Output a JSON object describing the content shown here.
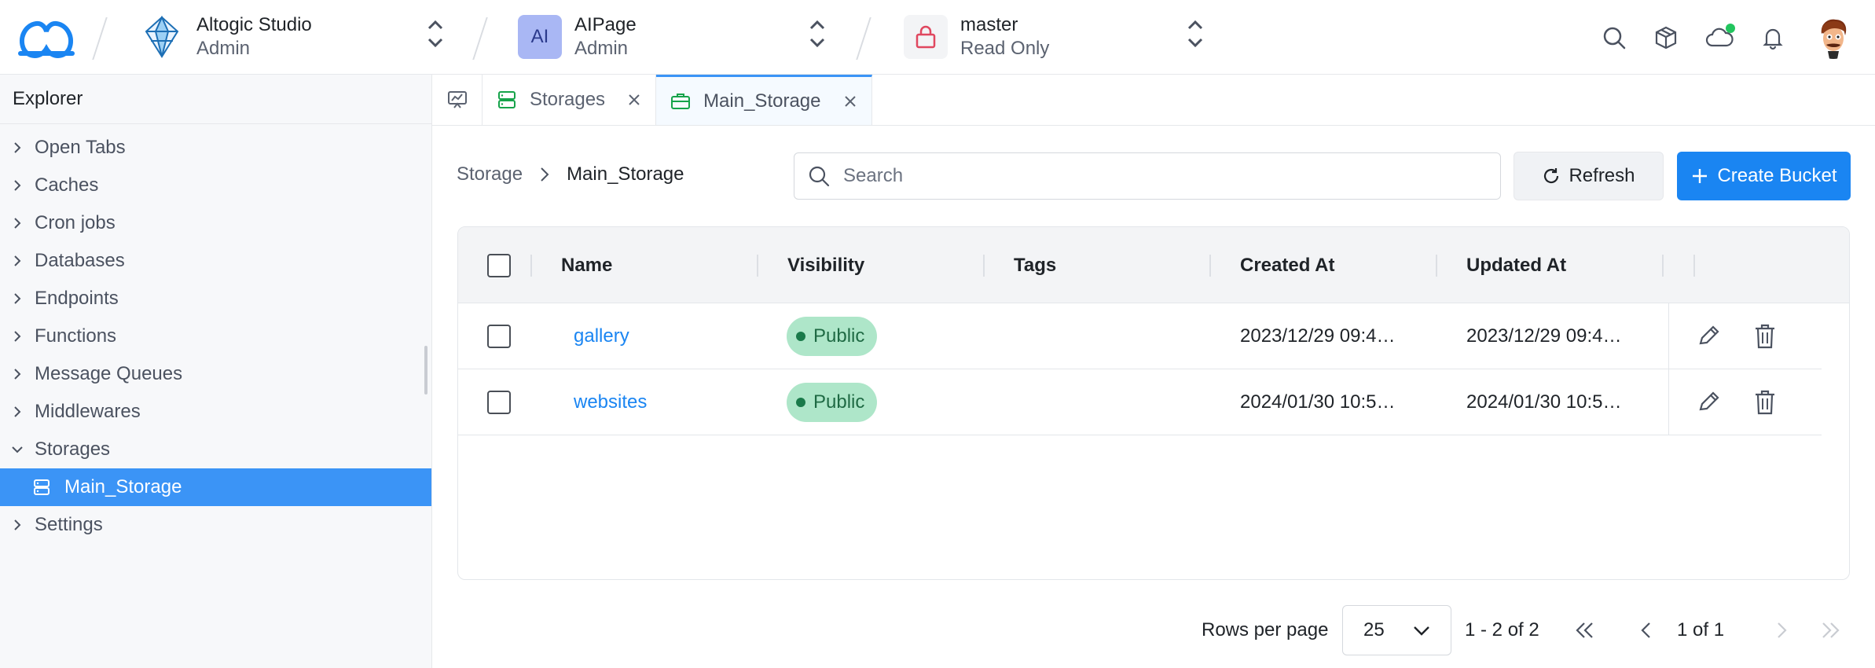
{
  "top_bar": {
    "org": {
      "name": "Altogic Studio",
      "role": "Admin"
    },
    "app": {
      "initials": "AI",
      "name": "AIPage",
      "role": "Admin"
    },
    "env": {
      "name": "master",
      "access": "Read Only"
    },
    "icons": [
      "search-icon",
      "package-icon",
      "cloud-icon",
      "bell-icon",
      "avatar"
    ]
  },
  "sidebar": {
    "title": "Explorer",
    "items": [
      {
        "label": "Open Tabs",
        "expanded": false
      },
      {
        "label": "Caches",
        "expanded": false
      },
      {
        "label": "Cron jobs",
        "expanded": false
      },
      {
        "label": "Databases",
        "expanded": false
      },
      {
        "label": "Endpoints",
        "expanded": false
      },
      {
        "label": "Functions",
        "expanded": false
      },
      {
        "label": "Message Queues",
        "expanded": false
      },
      {
        "label": "Middlewares",
        "expanded": false
      },
      {
        "label": "Storages",
        "expanded": true
      },
      {
        "label": "Main_Storage",
        "selected": true
      },
      {
        "label": "Settings",
        "expanded": false
      }
    ]
  },
  "tabs": [
    {
      "label": "Storages",
      "icon": "storage-icon",
      "active": false
    },
    {
      "label": "Main_Storage",
      "icon": "briefcase-icon",
      "active": true
    }
  ],
  "breadcrumb": {
    "parent": "Storage",
    "current": "Main_Storage"
  },
  "search": {
    "placeholder": "Search",
    "value": ""
  },
  "buttons": {
    "refresh": "Refresh",
    "create": "Create Bucket"
  },
  "table": {
    "columns": [
      "Name",
      "Visibility",
      "Tags",
      "Created At",
      "Updated At"
    ],
    "rows": [
      {
        "name": "gallery",
        "visibility": "Public",
        "tags": "",
        "created": "2023/12/29 09:4…",
        "updated": "2023/12/29 09:4…"
      },
      {
        "name": "websites",
        "visibility": "Public",
        "tags": "",
        "created": "2024/01/30 10:5…",
        "updated": "2024/01/30 10:5…"
      }
    ]
  },
  "pagination": {
    "rows_label": "Rows per page",
    "rows_value": "25",
    "range": "1 - 2 of 2",
    "page": "1 of 1"
  },
  "colors": {
    "accent": "#1a85f2",
    "selected": "#3b94f6",
    "badge_bg": "#aee6c9",
    "status_dot": "#22c55e"
  }
}
